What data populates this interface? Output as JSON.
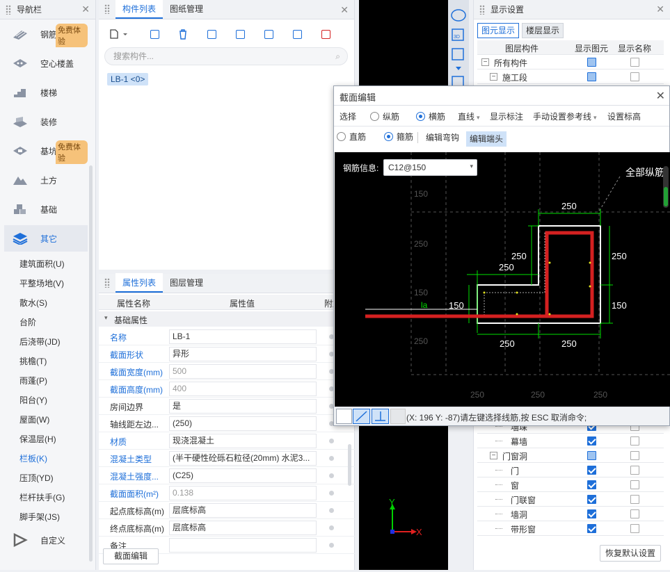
{
  "nav": {
    "title": "导航栏",
    "items": [
      {
        "label": "钢筋网",
        "badge": "免费体验"
      },
      {
        "label": "空心楼盖"
      },
      {
        "label": "楼梯"
      },
      {
        "label": "装修"
      },
      {
        "label": "基坑支护",
        "badge": "免费体验"
      },
      {
        "label": "土方"
      },
      {
        "label": "基础"
      },
      {
        "label": "其它"
      }
    ],
    "subitems": [
      "建筑面积(U)",
      "平整场地(V)",
      "散水(S)",
      "台阶",
      "后浇带(JD)",
      "挑檐(T)",
      "雨蓬(P)",
      "阳台(Y)",
      "屋面(W)",
      "保温层(H)",
      "栏板(K)",
      "压顶(YD)",
      "栏杆扶手(G)",
      "脚手架(JS)"
    ],
    "custom": "自定义"
  },
  "components": {
    "tabs": [
      "构件列表",
      "图纸管理"
    ],
    "search_placeholder": "搜索构件...",
    "selected_tag": "LB-1 <0>"
  },
  "properties": {
    "tabs": [
      "属性列表",
      "图层管理"
    ],
    "col_name": "属性名称",
    "col_value": "属性值",
    "col_extra": "附加",
    "group": "基础属性",
    "rows": [
      {
        "name": "名称",
        "value": "LB-1",
        "blue": true
      },
      {
        "name": "截面形状",
        "value": "异形",
        "blue": true
      },
      {
        "name": "截面宽度(mm)",
        "value": "500",
        "blue": true,
        "gray": true
      },
      {
        "name": "截面高度(mm)",
        "value": "400",
        "blue": true,
        "gray": true
      },
      {
        "name": "房间边界",
        "value": "是"
      },
      {
        "name": "轴线距左边...",
        "value": "(250)"
      },
      {
        "name": "材质",
        "value": "现浇混凝土",
        "blue": true
      },
      {
        "name": "混凝土类型",
        "value": "(半干硬性砼砾石粒径(20mm) 水泥3...",
        "blue": true
      },
      {
        "name": "混凝土强度...",
        "value": "(C25)",
        "blue": true
      },
      {
        "name": "截面面积(m²)",
        "value": "0.138",
        "blue": true,
        "gray": true
      },
      {
        "name": "起点底标高(m)",
        "value": "层底标高"
      },
      {
        "name": "终点底标高(m)",
        "value": "层底标高"
      },
      {
        "name": "备注",
        "value": ""
      }
    ],
    "bottom_button": "截面编辑"
  },
  "display": {
    "title": "显示设置",
    "tabs": [
      "图元显示",
      "楼层显示"
    ],
    "headers": [
      "图层构件",
      "显示图元",
      "显示名称"
    ],
    "top_rows": [
      {
        "label": "所有构件",
        "show": "part",
        "name": false,
        "level": 0,
        "toggle": "−"
      },
      {
        "label": "施工段",
        "show": "part",
        "name": false,
        "level": 1,
        "toggle": "−"
      }
    ],
    "bottom_rows": [
      {
        "label": "墙垛",
        "show": "on",
        "name": false,
        "level": 2
      },
      {
        "label": "幕墙",
        "show": "on",
        "name": false,
        "level": 2
      },
      {
        "label": "门窗洞",
        "show": "part",
        "name": false,
        "level": 1,
        "toggle": "−"
      },
      {
        "label": "门",
        "show": "on",
        "name": false,
        "level": 2
      },
      {
        "label": "窗",
        "show": "on",
        "name": false,
        "level": 2
      },
      {
        "label": "门联窗",
        "show": "on",
        "name": false,
        "level": 2
      },
      {
        "label": "墙洞",
        "show": "on",
        "name": false,
        "level": 2
      },
      {
        "label": "带形窗",
        "show": "on",
        "name": false,
        "level": 2
      }
    ],
    "restore_button": "恢复默认设置"
  },
  "dialog": {
    "title": "截面编辑",
    "toolbar1": [
      "选择",
      "纵筋",
      "横筋",
      "直线",
      "显示标注",
      "手动设置参考线",
      "设置标高"
    ],
    "toolbar2": [
      "直筋",
      "箍筋",
      "编辑弯钩",
      "编辑端头"
    ],
    "rebar_label": "钢筋信息:",
    "rebar_value": "C12@150",
    "canvas_text": {
      "all_long": "全部纵筋",
      "dims": [
        "250",
        "250",
        "250",
        "250",
        "150",
        "150",
        "250",
        "250"
      ],
      "la": "la",
      "gray_dims": [
        "150",
        "250",
        "150",
        "250",
        "250",
        "250",
        "250"
      ]
    },
    "status": "(X: 196 Y: -87)请左键选择线筋,按 ESC 取消命令;",
    "axis_x": "X",
    "axis_y": "Y"
  },
  "colors": {
    "accent": "#1e6fd9",
    "rebar": "#d42020",
    "dim": "#00e000"
  }
}
